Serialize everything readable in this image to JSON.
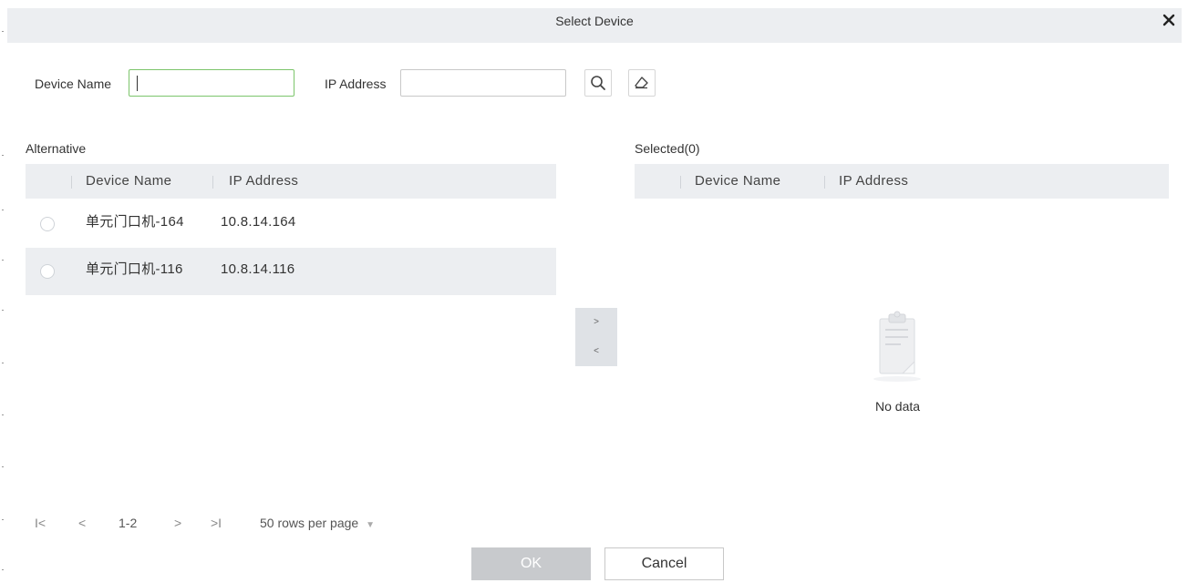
{
  "dialog": {
    "title": "Select Device"
  },
  "filters": {
    "device_name_label": "Device Name",
    "device_name_value": "",
    "ip_address_label": "IP Address",
    "ip_address_value": ""
  },
  "alternative": {
    "label": "Alternative",
    "columns": [
      "Device Name",
      "IP Address"
    ],
    "rows": [
      {
        "device_name": "单元门口机-164",
        "ip_address": "10.8.14.164"
      },
      {
        "device_name": "单元门口机-116",
        "ip_address": "10.8.14.116"
      }
    ]
  },
  "selected": {
    "label": "Selected(0)",
    "columns": [
      "Device Name",
      "IP Address"
    ],
    "empty_text": "No data"
  },
  "transfer": {
    "add": ">",
    "remove": "<"
  },
  "pagination": {
    "first": "I<",
    "prev": "<",
    "range": "1-2",
    "next": ">",
    "last": ">I",
    "page_size": "50 rows per page"
  },
  "buttons": {
    "ok": "OK",
    "cancel": "Cancel"
  },
  "colors": {
    "focus_border": "#7cc56b",
    "header_bg": "#eceef1",
    "ok_bg": "#c8cacd"
  }
}
